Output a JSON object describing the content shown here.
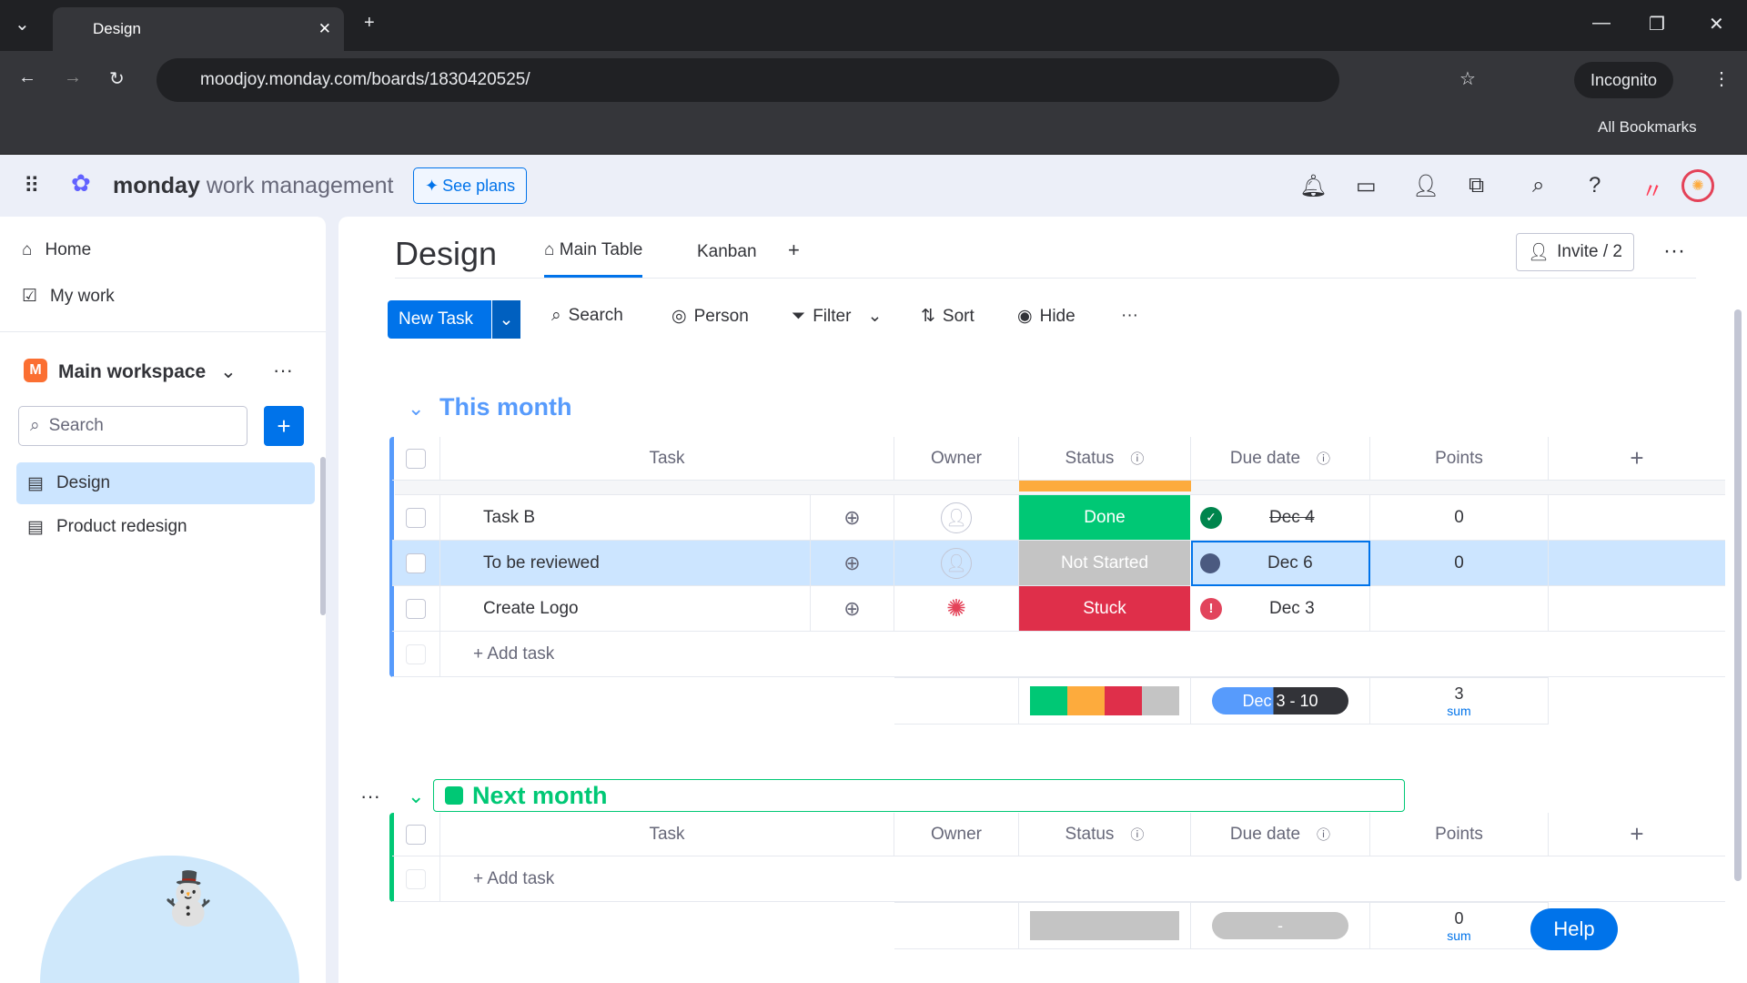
{
  "browser": {
    "tab_title": "Design",
    "url": "moodjoy.monday.com/boards/1830420525/",
    "incognito": "Incognito",
    "bookmarks": "All Bookmarks"
  },
  "app": {
    "brand": "monday",
    "brand_sub": "work management",
    "see_plans": "See plans"
  },
  "sidebar": {
    "home": "Home",
    "my_work": "My work",
    "workspace": "Main workspace",
    "workspace_initial": "M",
    "search_placeholder": "Search",
    "boards": [
      {
        "label": "Design",
        "active": true
      },
      {
        "label": "Product redesign",
        "active": false
      }
    ]
  },
  "board": {
    "title": "Design",
    "views": [
      {
        "label": "Main Table",
        "active": true
      },
      {
        "label": "Kanban",
        "active": false
      }
    ],
    "invite": "Invite / 2",
    "toolbar": {
      "new_task": "New Task",
      "search": "Search",
      "person": "Person",
      "filter": "Filter",
      "sort": "Sort",
      "hide": "Hide"
    }
  },
  "columns": {
    "task": "Task",
    "owner": "Owner",
    "status": "Status",
    "due": "Due date",
    "points": "Points"
  },
  "groups": [
    {
      "name": "This month",
      "color": "#579bfc",
      "rows": [
        {
          "task": "Task B",
          "status": "Done",
          "status_color": "#00c875",
          "due": "Dec 4",
          "due_done": true,
          "points": "0"
        },
        {
          "task": "To be reviewed",
          "status": "Not Started",
          "status_color": "#c4c4c4",
          "due": "Dec 6",
          "due_done": false,
          "points": "0",
          "selected": true
        },
        {
          "task": "Create Logo",
          "status": "Stuck",
          "status_color": "#df2f4a",
          "due": "Dec 3",
          "due_done": false,
          "points": ""
        }
      ],
      "add_task": "+ Add task",
      "summary": {
        "date_range": "Dec 3 - 10",
        "points": "3",
        "points_label": "sum"
      }
    },
    {
      "name": "Next month",
      "color": "#00c875",
      "rows": [],
      "add_task": "+ Add task",
      "summary": {
        "date_range": "-",
        "points": "0",
        "points_label": "sum"
      }
    }
  ],
  "help": "Help"
}
